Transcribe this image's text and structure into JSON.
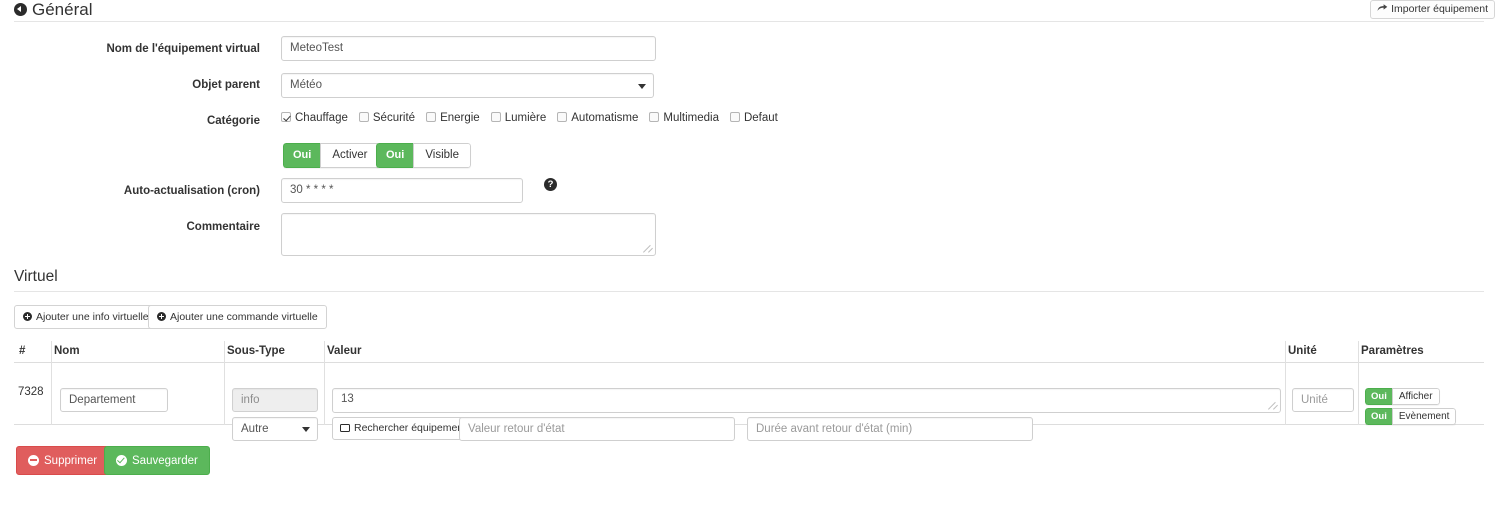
{
  "header": {
    "title": "Général",
    "back_icon": "back-circle-icon",
    "import_button": {
      "label": "Importer équipement",
      "icon": "share-arrow-icon"
    }
  },
  "form": {
    "name": {
      "label": "Nom de l'équipement virtual",
      "value": "MeteoTest"
    },
    "parent": {
      "label": "Objet parent",
      "value": "Météo",
      "caret_icon": "chevron-down-icon"
    },
    "category": {
      "label": "Catégorie",
      "items": [
        {
          "label": "Chauffage",
          "checked": true
        },
        {
          "label": "Sécurité",
          "checked": false
        },
        {
          "label": "Energie",
          "checked": false
        },
        {
          "label": "Lumière",
          "checked": false
        },
        {
          "label": "Automatisme",
          "checked": false
        },
        {
          "label": "Multimedia",
          "checked": false
        },
        {
          "label": "Defaut",
          "checked": false
        }
      ]
    },
    "toggles": [
      {
        "on_label": "Oui",
        "label": "Activer"
      },
      {
        "on_label": "Oui",
        "label": "Visible"
      }
    ],
    "cron": {
      "label": "Auto-actualisation (cron)",
      "value": "30 * * * *",
      "help_icon": "question-mark-icon",
      "help_glyph": "?"
    },
    "comment": {
      "label": "Commentaire",
      "value": "",
      "resize_icon": "resize-grip-icon"
    }
  },
  "virtuel": {
    "title": "Virtuel",
    "add_info_button": {
      "label": "Ajouter une info virtuelle",
      "icon": "plus-circle-icon"
    },
    "add_command_button": {
      "label": "Ajouter une commande virtuelle",
      "icon": "plus-circle-icon"
    },
    "table": {
      "columns": [
        "#",
        "Nom",
        "Sous-Type",
        "Valeur",
        "Unité",
        "Paramètres"
      ],
      "rows": [
        {
          "id": "7328",
          "name_value": "Departement",
          "subtype_value": "info",
          "subtype_select": "Autre",
          "value": "13",
          "search_button": {
            "label": "Rechercher équipement",
            "icon": "monitor-icon"
          },
          "return_value_placeholder": "Valeur retour d'état",
          "return_duration_placeholder": "Durée avant retour d'état (min)",
          "unit_placeholder": "Unité",
          "params": [
            {
              "on_label": "Oui",
              "label": "Afficher"
            },
            {
              "on_label": "Oui",
              "label": "Evènement"
            }
          ]
        }
      ]
    }
  },
  "footer": {
    "delete_button": {
      "label": "Supprimer",
      "icon": "minus-circle-icon"
    },
    "save_button": {
      "label": "Sauvegarder",
      "icon": "check-circle-icon"
    }
  },
  "colors": {
    "success": "#5cb85c",
    "danger": "#e05d5d",
    "border": "#cfcfcf",
    "text": "#333333",
    "muted": "#9a9a9a"
  }
}
